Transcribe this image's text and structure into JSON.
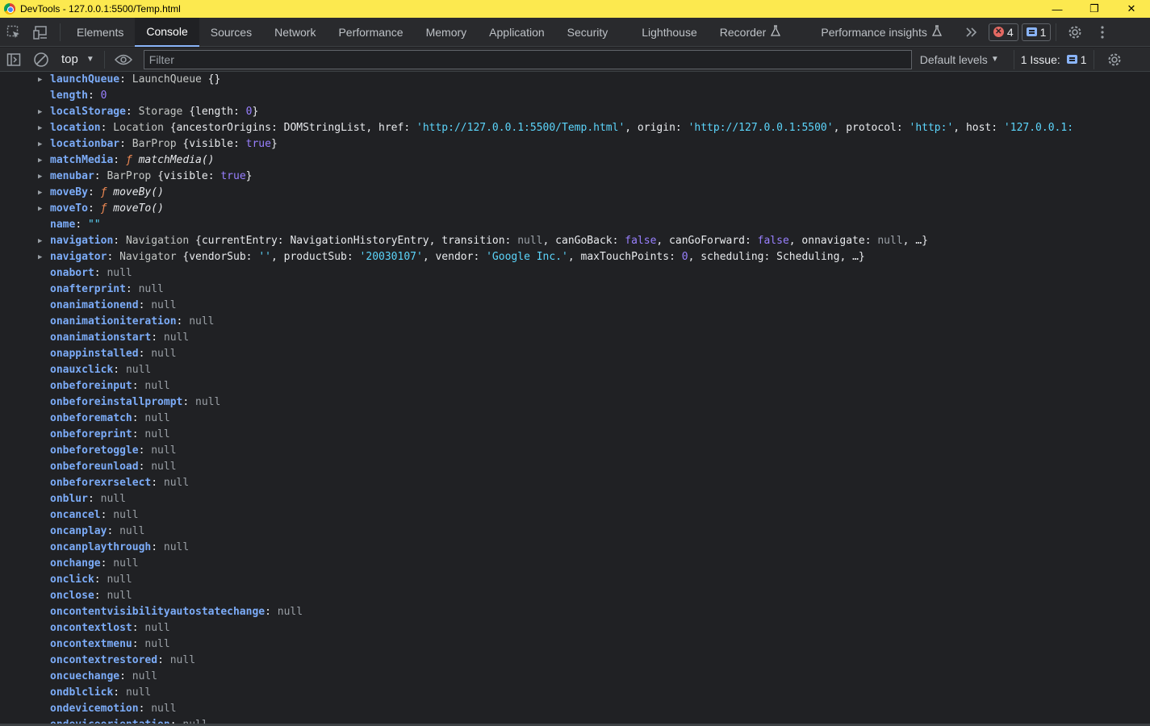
{
  "window": {
    "title": "DevTools - 127.0.0.1:5500/Temp.html"
  },
  "tabs": [
    {
      "label": "Elements",
      "active": false
    },
    {
      "label": "Console",
      "active": true
    },
    {
      "label": "Sources",
      "active": false
    },
    {
      "label": "Network",
      "active": false
    },
    {
      "label": "Performance",
      "active": false
    },
    {
      "label": "Memory",
      "active": false
    },
    {
      "label": "Application",
      "active": false
    },
    {
      "label": "Security",
      "active": false
    },
    {
      "label": "Lighthouse",
      "active": false
    },
    {
      "label": "Recorder",
      "active": false
    },
    {
      "label": "Performance insights",
      "active": false
    }
  ],
  "badges": {
    "errors": "4",
    "messages": "1"
  },
  "toolbar": {
    "context": "top",
    "filter_placeholder": "Filter",
    "levels": "Default levels",
    "issues_label": "1 Issue:",
    "issues_count": "1"
  },
  "console_rows": [
    {
      "expand": true,
      "key": "launchQueue",
      "parts": [
        {
          "c": "t",
          "v": "LaunchQueue "
        },
        {
          "c": "p",
          "v": "{}"
        }
      ]
    },
    {
      "expand": false,
      "key": "length",
      "parts": [
        {
          "c": "n",
          "v": "0"
        }
      ]
    },
    {
      "expand": true,
      "key": "localStorage",
      "parts": [
        {
          "c": "t",
          "v": "Storage "
        },
        {
          "c": "p",
          "v": "{length: "
        },
        {
          "c": "n",
          "v": "0"
        },
        {
          "c": "p",
          "v": "}"
        }
      ]
    },
    {
      "expand": true,
      "key": "location",
      "parts": [
        {
          "c": "t",
          "v": "Location "
        },
        {
          "c": "p",
          "v": "{ancestorOrigins: "
        },
        {
          "c": "obj",
          "v": "DOMStringList"
        },
        {
          "c": "p",
          "v": ", href: "
        },
        {
          "c": "s",
          "v": "'http://127.0.0.1:5500/Temp.html'"
        },
        {
          "c": "p",
          "v": ", origin: "
        },
        {
          "c": "s",
          "v": "'http://127.0.0.1:5500'"
        },
        {
          "c": "p",
          "v": ", protocol: "
        },
        {
          "c": "s",
          "v": "'http:'"
        },
        {
          "c": "p",
          "v": ", host: "
        },
        {
          "c": "s",
          "v": "'127.0.0.1:"
        }
      ]
    },
    {
      "expand": true,
      "key": "locationbar",
      "parts": [
        {
          "c": "t",
          "v": "BarProp "
        },
        {
          "c": "p",
          "v": "{visible: "
        },
        {
          "c": "bool",
          "v": "true"
        },
        {
          "c": "p",
          "v": "}"
        }
      ]
    },
    {
      "expand": true,
      "key": "matchMedia",
      "parts": [
        {
          "c": "fn",
          "v": "ƒ "
        },
        {
          "c": "fname",
          "v": "matchMedia()"
        }
      ]
    },
    {
      "expand": true,
      "key": "menubar",
      "parts": [
        {
          "c": "t",
          "v": "BarProp "
        },
        {
          "c": "p",
          "v": "{visible: "
        },
        {
          "c": "bool",
          "v": "true"
        },
        {
          "c": "p",
          "v": "}"
        }
      ]
    },
    {
      "expand": true,
      "key": "moveBy",
      "parts": [
        {
          "c": "fn",
          "v": "ƒ "
        },
        {
          "c": "fname",
          "v": "moveBy()"
        }
      ]
    },
    {
      "expand": true,
      "key": "moveTo",
      "parts": [
        {
          "c": "fn",
          "v": "ƒ "
        },
        {
          "c": "fname",
          "v": "moveTo()"
        }
      ]
    },
    {
      "expand": false,
      "key": "name",
      "parts": [
        {
          "c": "s",
          "v": "\"\""
        }
      ]
    },
    {
      "expand": true,
      "key": "navigation",
      "parts": [
        {
          "c": "t",
          "v": "Navigation "
        },
        {
          "c": "p",
          "v": "{currentEntry: "
        },
        {
          "c": "obj",
          "v": "NavigationHistoryEntry"
        },
        {
          "c": "p",
          "v": ", transition: "
        },
        {
          "c": "nul",
          "v": "null"
        },
        {
          "c": "p",
          "v": ", canGoBack: "
        },
        {
          "c": "bool",
          "v": "false"
        },
        {
          "c": "p",
          "v": ", canGoForward: "
        },
        {
          "c": "bool",
          "v": "false"
        },
        {
          "c": "p",
          "v": ", onnavigate: "
        },
        {
          "c": "nul",
          "v": "null"
        },
        {
          "c": "p",
          "v": ", …}"
        }
      ]
    },
    {
      "expand": true,
      "key": "navigator",
      "parts": [
        {
          "c": "t",
          "v": "Navigator "
        },
        {
          "c": "p",
          "v": "{vendorSub: "
        },
        {
          "c": "s",
          "v": "''"
        },
        {
          "c": "p",
          "v": ", productSub: "
        },
        {
          "c": "s",
          "v": "'20030107'"
        },
        {
          "c": "p",
          "v": ", vendor: "
        },
        {
          "c": "s",
          "v": "'Google Inc.'"
        },
        {
          "c": "p",
          "v": ", maxTouchPoints: "
        },
        {
          "c": "n",
          "v": "0"
        },
        {
          "c": "p",
          "v": ", scheduling: "
        },
        {
          "c": "obj",
          "v": "Scheduling"
        },
        {
          "c": "p",
          "v": ", …}"
        }
      ]
    },
    {
      "expand": false,
      "key": "onabort",
      "parts": [
        {
          "c": "nul",
          "v": "null"
        }
      ]
    },
    {
      "expand": false,
      "key": "onafterprint",
      "parts": [
        {
          "c": "nul",
          "v": "null"
        }
      ]
    },
    {
      "expand": false,
      "key": "onanimationend",
      "parts": [
        {
          "c": "nul",
          "v": "null"
        }
      ]
    },
    {
      "expand": false,
      "key": "onanimationiteration",
      "parts": [
        {
          "c": "nul",
          "v": "null"
        }
      ]
    },
    {
      "expand": false,
      "key": "onanimationstart",
      "parts": [
        {
          "c": "nul",
          "v": "null"
        }
      ]
    },
    {
      "expand": false,
      "key": "onappinstalled",
      "parts": [
        {
          "c": "nul",
          "v": "null"
        }
      ]
    },
    {
      "expand": false,
      "key": "onauxclick",
      "parts": [
        {
          "c": "nul",
          "v": "null"
        }
      ]
    },
    {
      "expand": false,
      "key": "onbeforeinput",
      "parts": [
        {
          "c": "nul",
          "v": "null"
        }
      ]
    },
    {
      "expand": false,
      "key": "onbeforeinstallprompt",
      "parts": [
        {
          "c": "nul",
          "v": "null"
        }
      ]
    },
    {
      "expand": false,
      "key": "onbeforematch",
      "parts": [
        {
          "c": "nul",
          "v": "null"
        }
      ]
    },
    {
      "expand": false,
      "key": "onbeforeprint",
      "parts": [
        {
          "c": "nul",
          "v": "null"
        }
      ]
    },
    {
      "expand": false,
      "key": "onbeforetoggle",
      "parts": [
        {
          "c": "nul",
          "v": "null"
        }
      ]
    },
    {
      "expand": false,
      "key": "onbeforeunload",
      "parts": [
        {
          "c": "nul",
          "v": "null"
        }
      ]
    },
    {
      "expand": false,
      "key": "onbeforexrselect",
      "parts": [
        {
          "c": "nul",
          "v": "null"
        }
      ]
    },
    {
      "expand": false,
      "key": "onblur",
      "parts": [
        {
          "c": "nul",
          "v": "null"
        }
      ]
    },
    {
      "expand": false,
      "key": "oncancel",
      "parts": [
        {
          "c": "nul",
          "v": "null"
        }
      ]
    },
    {
      "expand": false,
      "key": "oncanplay",
      "parts": [
        {
          "c": "nul",
          "v": "null"
        }
      ]
    },
    {
      "expand": false,
      "key": "oncanplaythrough",
      "parts": [
        {
          "c": "nul",
          "v": "null"
        }
      ]
    },
    {
      "expand": false,
      "key": "onchange",
      "parts": [
        {
          "c": "nul",
          "v": "null"
        }
      ]
    },
    {
      "expand": false,
      "key": "onclick",
      "parts": [
        {
          "c": "nul",
          "v": "null"
        }
      ]
    },
    {
      "expand": false,
      "key": "onclose",
      "parts": [
        {
          "c": "nul",
          "v": "null"
        }
      ]
    },
    {
      "expand": false,
      "key": "oncontentvisibilityautostatechange",
      "parts": [
        {
          "c": "nul",
          "v": "null"
        }
      ]
    },
    {
      "expand": false,
      "key": "oncontextlost",
      "parts": [
        {
          "c": "nul",
          "v": "null"
        }
      ]
    },
    {
      "expand": false,
      "key": "oncontextmenu",
      "parts": [
        {
          "c": "nul",
          "v": "null"
        }
      ]
    },
    {
      "expand": false,
      "key": "oncontextrestored",
      "parts": [
        {
          "c": "nul",
          "v": "null"
        }
      ]
    },
    {
      "expand": false,
      "key": "oncuechange",
      "parts": [
        {
          "c": "nul",
          "v": "null"
        }
      ]
    },
    {
      "expand": false,
      "key": "ondblclick",
      "parts": [
        {
          "c": "nul",
          "v": "null"
        }
      ]
    },
    {
      "expand": false,
      "key": "ondevicemotion",
      "parts": [
        {
          "c": "nul",
          "v": "null"
        }
      ]
    },
    {
      "expand": false,
      "key": "ondeviceorientation",
      "parts": [
        {
          "c": "nul",
          "v": "null"
        }
      ]
    }
  ]
}
